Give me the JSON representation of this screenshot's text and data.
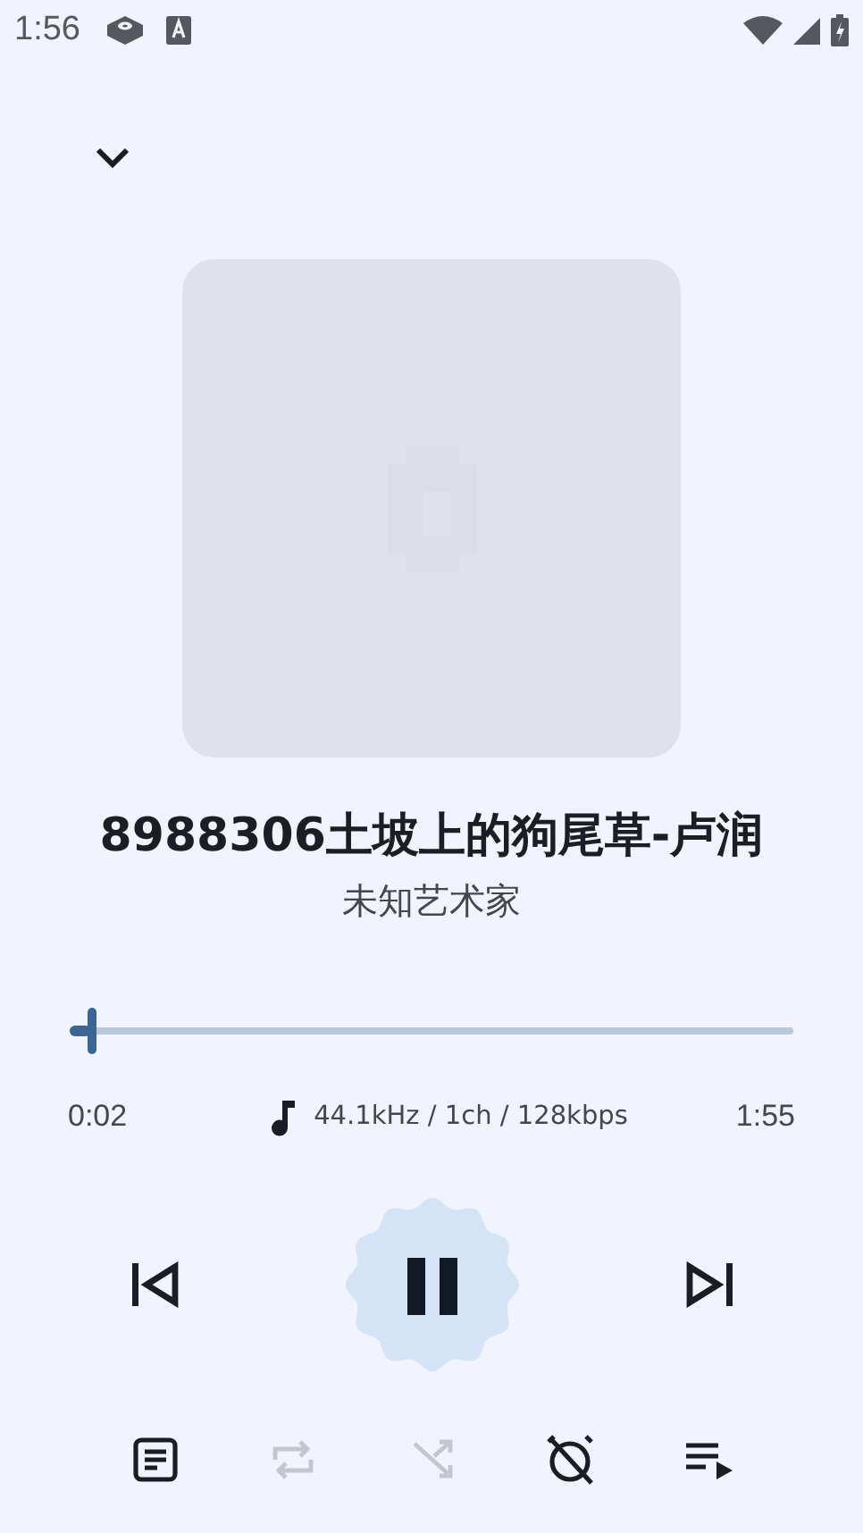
{
  "status_bar": {
    "time": "1:56"
  },
  "track": {
    "title": "8988306土坡上的狗尾草-卢润",
    "artist": "未知艺术家"
  },
  "progress": {
    "level": 0.03,
    "elapsed": "0:02",
    "total": "1:55",
    "format": "44.1kHz / 1ch / 128kbps"
  },
  "playback": {
    "playing": true
  },
  "actions": [
    {
      "kind": "lyrics",
      "disabled": false
    },
    {
      "kind": "repeat",
      "disabled": true
    },
    {
      "kind": "shuffle",
      "disabled": true
    },
    {
      "kind": "timer",
      "disabled": false
    },
    {
      "kind": "queue",
      "disabled": false
    }
  ]
}
